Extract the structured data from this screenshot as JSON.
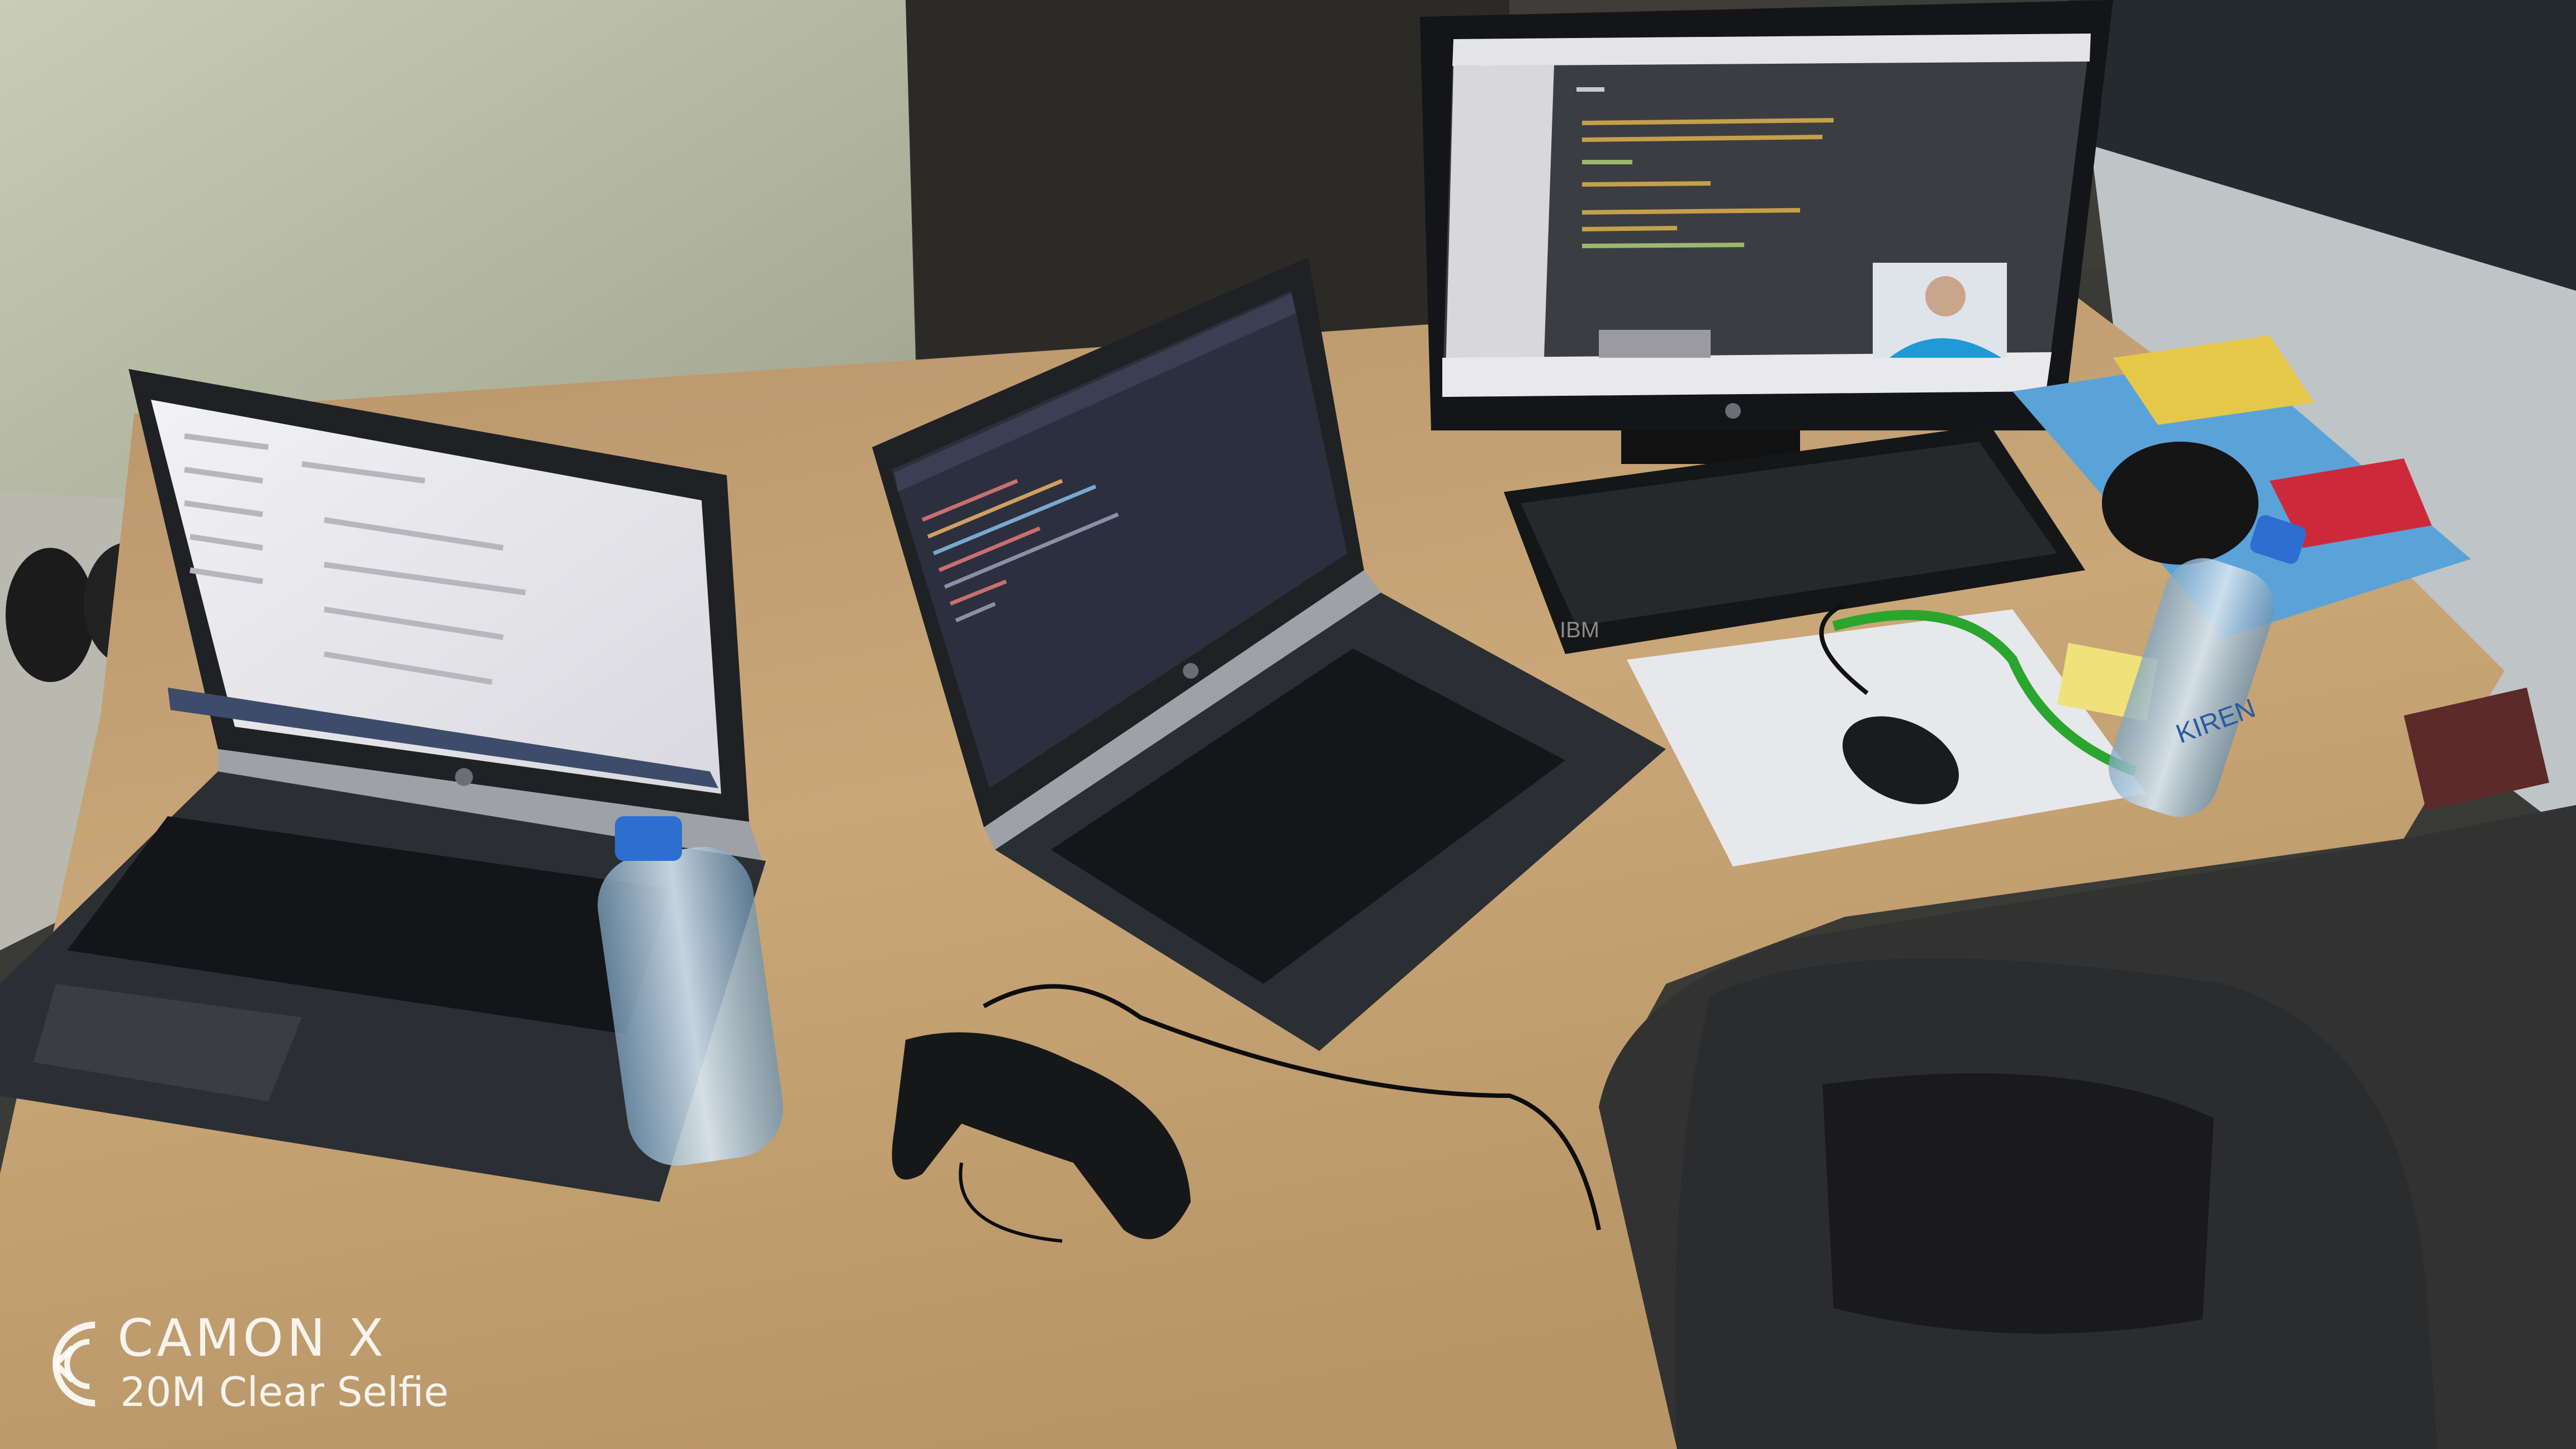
{
  "photo": {
    "watermark": {
      "brand": "CAMON X",
      "tagline": "20M Clear Selfie"
    },
    "labels": {
      "keyboard_brand": "IBM",
      "bottle_brand": "KIREN"
    }
  },
  "colors": {
    "wall": "#c9cdb6",
    "desk": "#c9a779",
    "laptop_body": "#2b2e33",
    "laptop_silver": "#9ea2a6",
    "screen_light": "#e9e8ea",
    "editor_dark": "#2c2f3d",
    "lanyard": "#2aa52e",
    "bottle_cap": "#2c6fd0"
  },
  "icons": [
    "hp-logo-icon",
    "camera-lens-icon"
  ]
}
